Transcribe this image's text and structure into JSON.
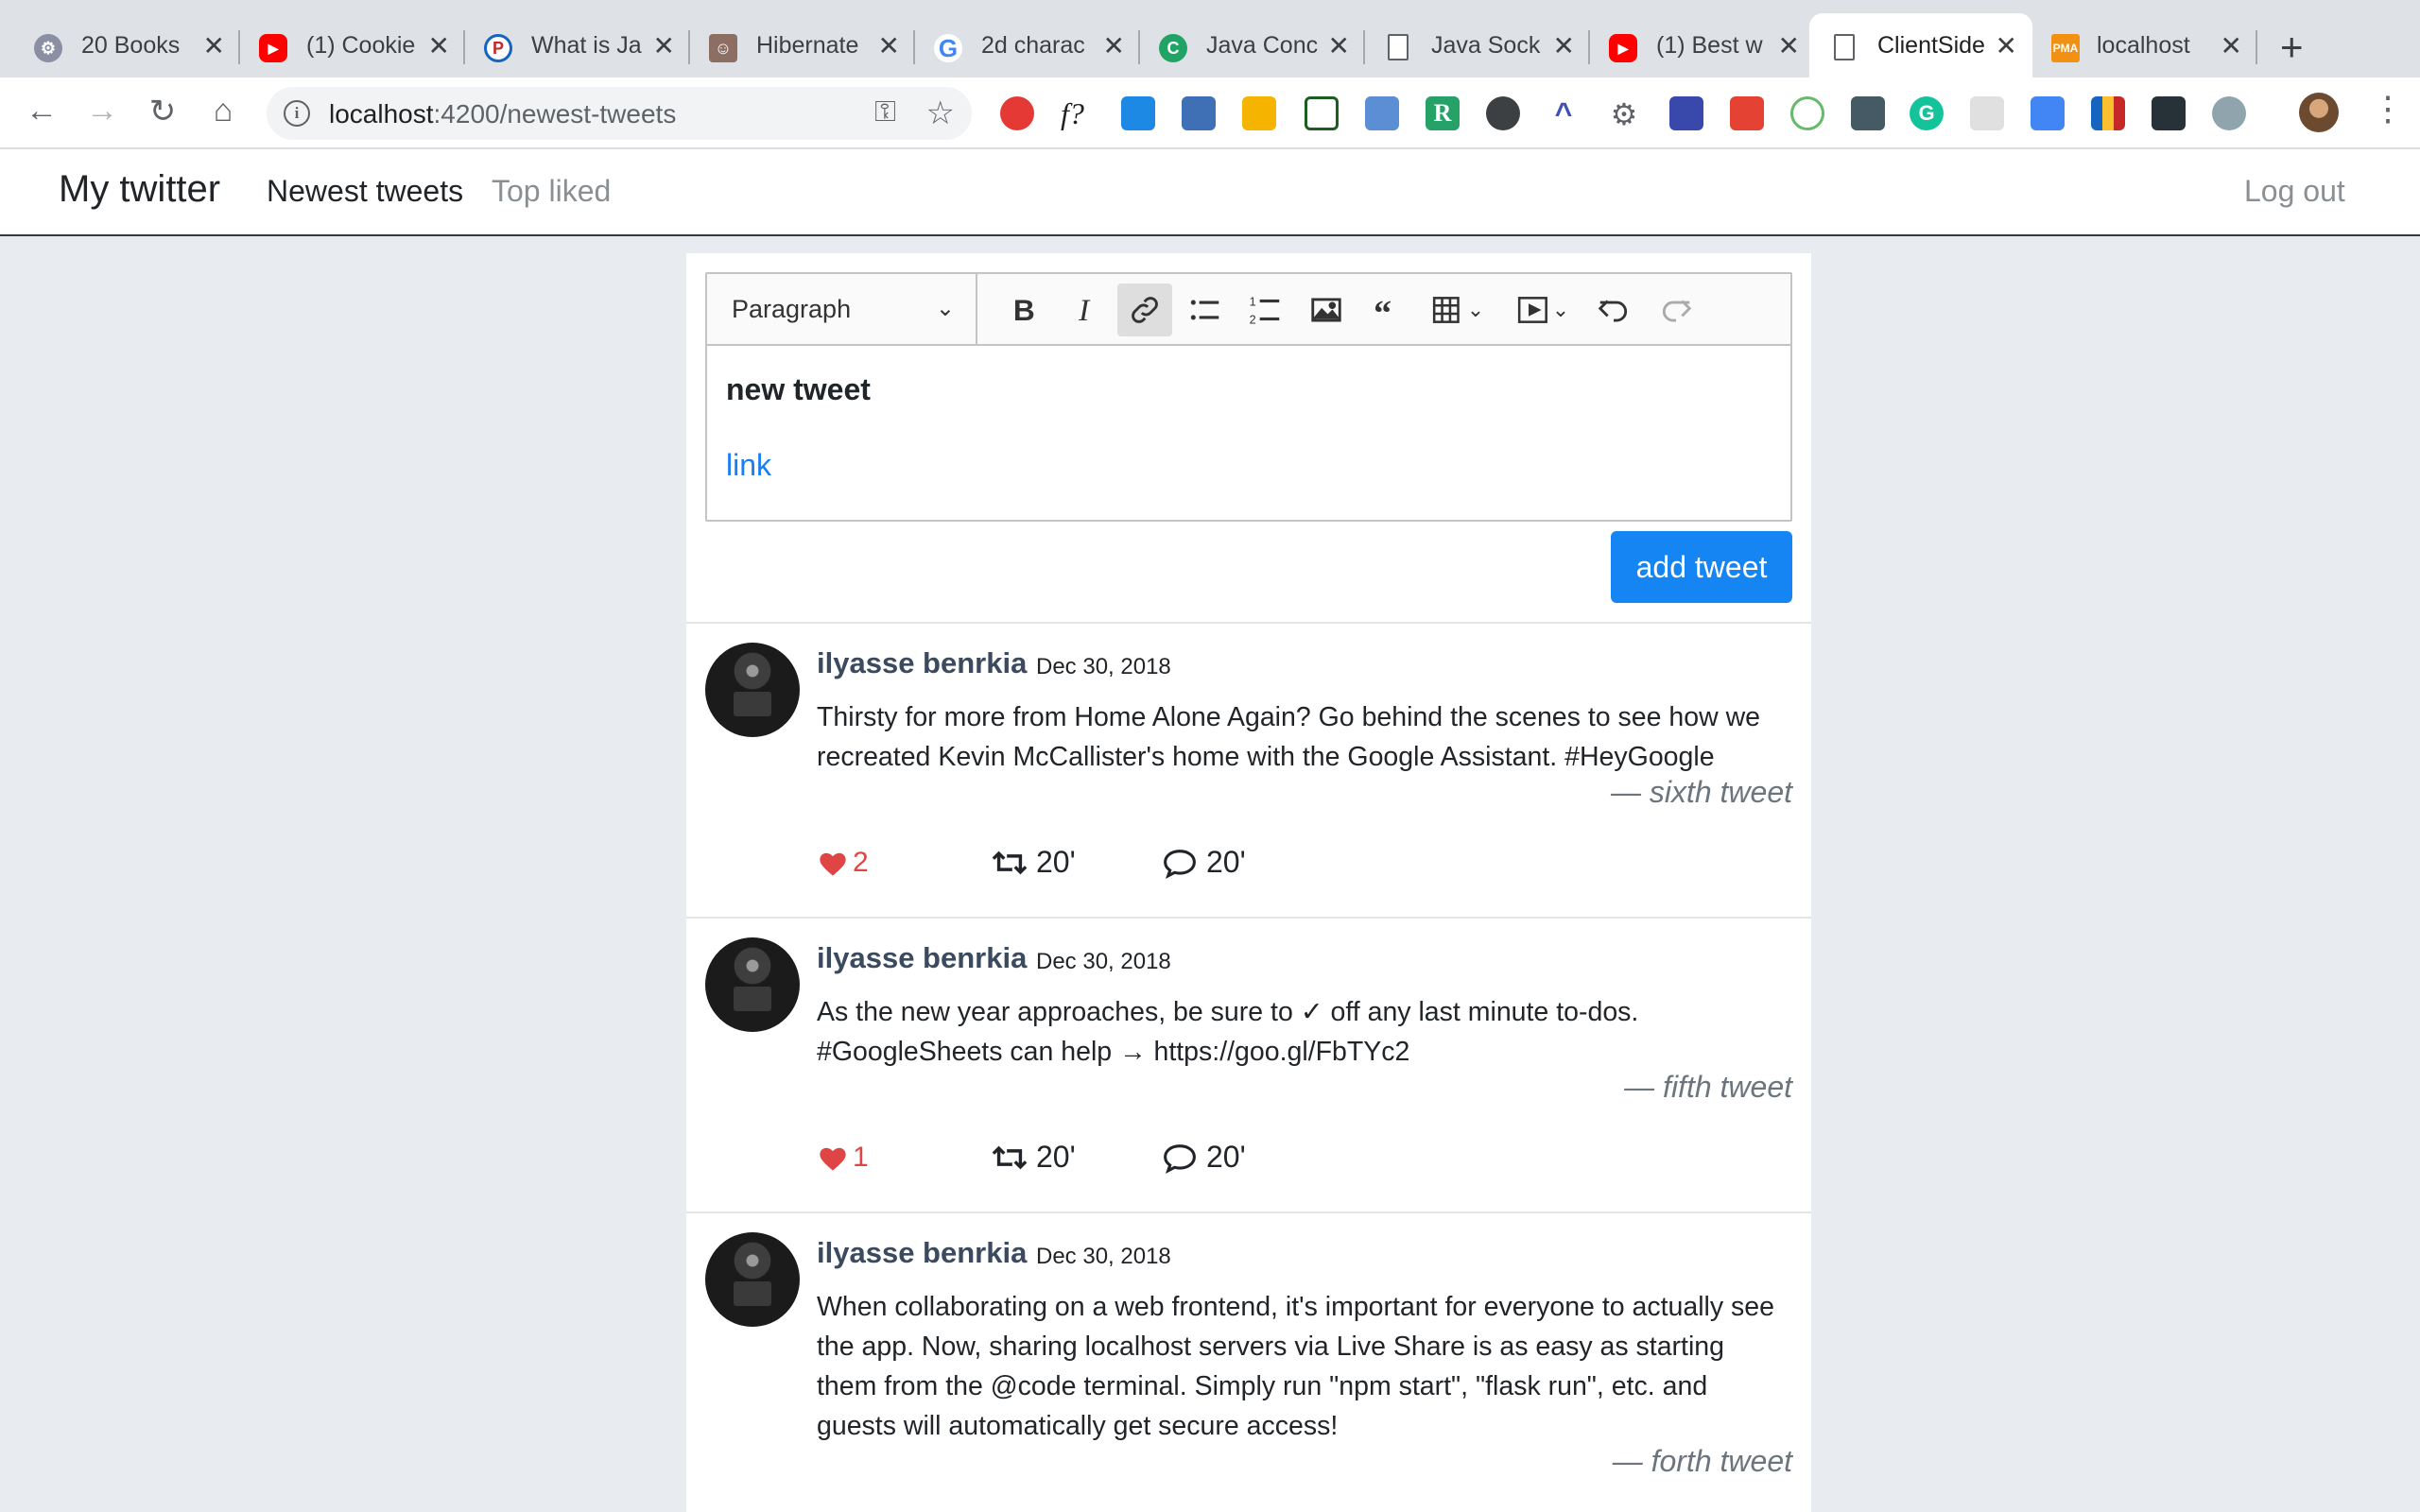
{
  "browser": {
    "tabs": [
      {
        "title": "20 Books",
        "icon": "gear-favicon",
        "color": "#8a8fa3"
      },
      {
        "title": "(1) Cookie",
        "icon": "youtube-favicon",
        "color": "#ff0000"
      },
      {
        "title": "What is Ja",
        "icon": "p-favicon",
        "color": "#c62828"
      },
      {
        "title": "Hibernate",
        "icon": "person-favicon",
        "color": "#8d6e63"
      },
      {
        "title": "2d charac",
        "icon": "google-favicon",
        "color": "#4285f4"
      },
      {
        "title": "Java Conc",
        "icon": "c-favicon",
        "color": "#21a366"
      },
      {
        "title": "Java Sock",
        "icon": "doc-favicon",
        "color": "#9aa0a6"
      },
      {
        "title": "(1) Best w",
        "icon": "youtube-favicon",
        "color": "#ff0000"
      },
      {
        "title": "ClientSide",
        "icon": "doc-favicon",
        "color": "#9aa0a6",
        "active": true
      },
      {
        "title": "localhost",
        "icon": "pma-favicon",
        "color": "#f29111"
      }
    ],
    "url_host": "localhost",
    "url_path": ":4200/newest-tweets"
  },
  "app": {
    "brand": "My twitter",
    "nav": {
      "newest": "Newest tweets",
      "top_liked": "Top liked",
      "logout": "Log out"
    }
  },
  "editor": {
    "heading_option": "Paragraph",
    "content_bold": "new tweet",
    "content_link": "link",
    "submit_label": "add tweet",
    "colors": {
      "button": "#1585f4",
      "link": "#1a7ef2"
    }
  },
  "tweets": [
    {
      "author": "ilyasse benrkia",
      "date": "Dec 30, 2018",
      "body": "Thirsty for more from Home Alone Again? Go behind the scenes to see how we recreated Kevin McCallister's home with the Google Assistant. #HeyGoogle",
      "signature": "— sixth tweet",
      "likes": "2",
      "retweets": "20'",
      "comments": "20'"
    },
    {
      "author": "ilyasse benrkia",
      "date": "Dec 30, 2018",
      "body": "As the new year approaches, be sure to ✓ off any last minute to-dos. #GoogleSheets can help → https://goo.gl/FbTYc2",
      "signature": "— fifth tweet",
      "likes": "1",
      "retweets": "20'",
      "comments": "20'"
    },
    {
      "author": "ilyasse benrkia",
      "date": "Dec 30, 2018",
      "body": "When collaborating on a web frontend, it's important for everyone to actually see the app. Now, sharing localhost servers via Live Share is as easy as starting them from the @code terminal. Simply run \"npm start\", \"flask run\", etc. and guests will automatically get secure access!",
      "signature": "— forth tweet"
    }
  ]
}
